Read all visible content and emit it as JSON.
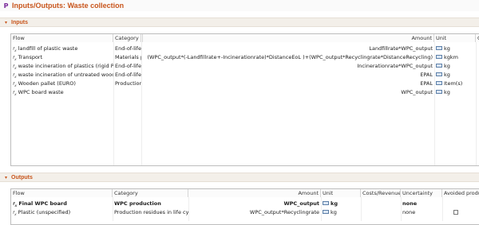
{
  "app": {
    "icon": "P",
    "title": "Inputs/Outputs: Waste collection"
  },
  "inputs": {
    "section_label": "Inputs",
    "columns": {
      "flow": "Flow",
      "category": "Category",
      "amount": "Amount",
      "unit": "Unit",
      "extra": "C"
    },
    "rows": [
      {
        "flow": "landfill of plastic waste",
        "category": "End-of-life",
        "amount": "Landfillrate*WPC_output",
        "unit": "kg"
      },
      {
        "flow": "Transport",
        "category": "Materials p",
        "amount": "(WPC_output*(-Landfillrate+-Incinerationrate)*DistanceEoL )+(WPC_output*Recyclingrate*DistanceRecycling)",
        "unit": "kgkm"
      },
      {
        "flow": "waste incineration of plastics (rigid P",
        "category": "End-of-life",
        "amount": "Incinerationrate*WPC_output",
        "unit": "kg"
      },
      {
        "flow": "waste incineration of untreated wood",
        "category": "End-of-life",
        "amount": "EPAL",
        "unit": "kg"
      },
      {
        "flow": "Wooden pallet (EURO)",
        "category": "Production",
        "amount": "EPAL",
        "unit": "Item(s)"
      },
      {
        "flow": "WPC board waste",
        "category": "",
        "amount": "WPC_output",
        "unit": "kg"
      }
    ]
  },
  "outputs": {
    "section_label": "Outputs",
    "columns": {
      "flow": "Flow",
      "category": "Category",
      "amount": "Amount",
      "unit": "Unit",
      "costs": "Costs/Revenues",
      "uncertainty": "Uncertainty",
      "avoided": "Avoided produ"
    },
    "rows": [
      {
        "flow": "Final WPC board",
        "category": "WPC production",
        "amount": "WPC_output",
        "unit": "kg",
        "costs": "",
        "uncertainty": "none",
        "avoided": false,
        "bold": true
      },
      {
        "flow": "Plastic (unspecified)",
        "category": "Production residues in life cyc",
        "amount": "WPC_output*Recyclingrate",
        "unit": "kg",
        "costs": "",
        "uncertainty": "none",
        "avoided": false,
        "bold": false
      }
    ]
  },
  "icons": {
    "flow": "fx-flow-icon",
    "unit": "unit-group-icon",
    "collapse": "chevron-down-icon"
  },
  "colors": {
    "accent": "#c8551c",
    "header_bg": "#f3efe9",
    "app_icon": "#7a2a9a"
  }
}
